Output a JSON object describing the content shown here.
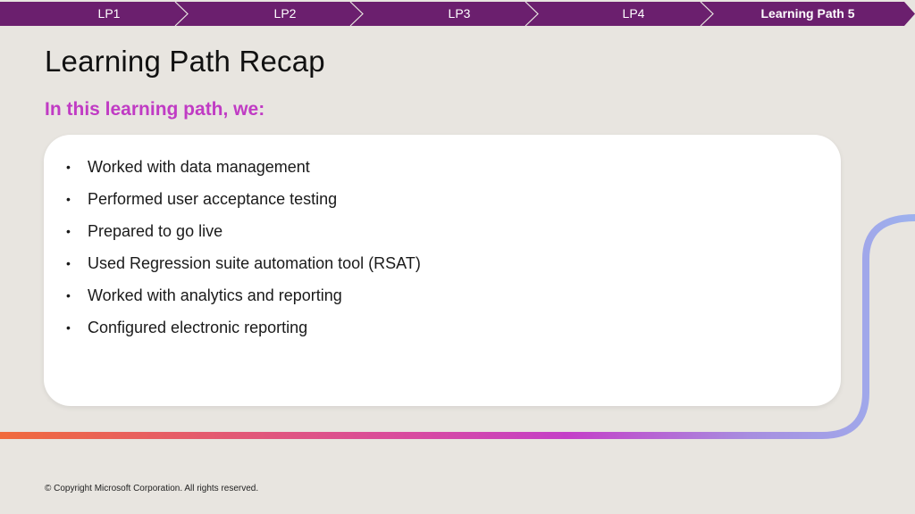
{
  "nav": {
    "items": [
      {
        "label": "LP1",
        "active": false
      },
      {
        "label": "LP2",
        "active": false
      },
      {
        "label": "LP3",
        "active": false
      },
      {
        "label": "LP4",
        "active": false
      },
      {
        "label": "Learning Path 5",
        "active": true
      }
    ],
    "color": "#6b1f6e"
  },
  "slide": {
    "title": "Learning Path Recap",
    "subtitle": "In this learning path, we:",
    "bullets": [
      "Worked with data management",
      "Performed user acceptance testing",
      "Prepared to go live",
      "Used Regression suite automation tool (RSAT)",
      "Worked with analytics and reporting",
      "Configured electronic reporting"
    ]
  },
  "footer": {
    "copyright": "© Copyright Microsoft Corporation. All rights reserved."
  },
  "colors": {
    "background": "#e8e5e0",
    "subtitle": "#c03bc4",
    "line_start": "#f06a3c",
    "line_mid": "#c43fc8",
    "line_end": "#9db2ee"
  }
}
